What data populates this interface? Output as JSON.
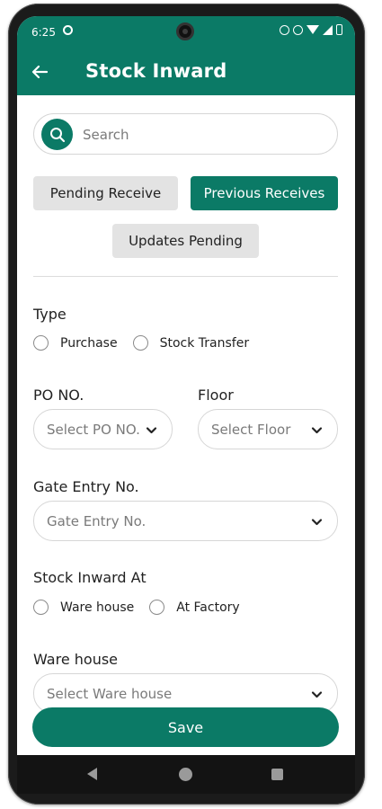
{
  "status_bar": {
    "time": "6:25",
    "icons": [
      "dnd-icon",
      "vibrate-icon",
      "wifi-icon",
      "signal-icon",
      "battery-icon"
    ]
  },
  "app_bar": {
    "title": "Stock Inward",
    "back_icon": "arrow-left-icon"
  },
  "search": {
    "placeholder": "Search",
    "value": "",
    "icon": "search-icon"
  },
  "tabs": [
    {
      "label": "Pending Receive",
      "active": false
    },
    {
      "label": "Previous Receives",
      "active": true
    },
    {
      "label": "Updates Pending",
      "active": false
    }
  ],
  "form": {
    "type": {
      "label": "Type",
      "options": [
        "Purchase",
        "Stock Transfer"
      ]
    },
    "po_no": {
      "label": "PO NO.",
      "placeholder": "Select PO NO."
    },
    "floor": {
      "label": "Floor",
      "placeholder": "Select Floor"
    },
    "gate_entry": {
      "label": "Gate Entry No.",
      "placeholder": "Gate Entry No."
    },
    "stock_inward_at": {
      "label": "Stock Inward At",
      "options": [
        "Ware house",
        "At Factory"
      ]
    },
    "ware_house": {
      "label": "Ware house",
      "placeholder": "Select Ware house"
    }
  },
  "save_label": "Save",
  "colors": {
    "brand": "#0b7a66",
    "tab_inactive": "#e3e3e3",
    "nav_bar": "#131313"
  }
}
